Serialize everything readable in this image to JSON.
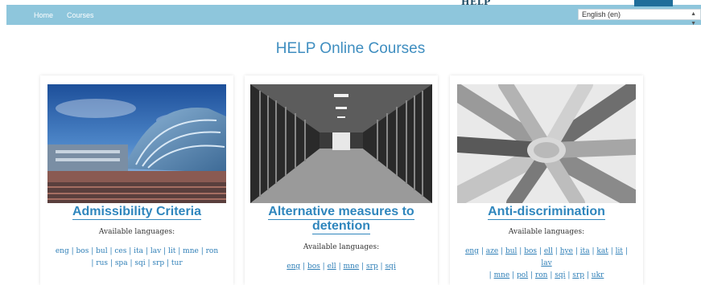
{
  "nav": {
    "home": "Home",
    "courses": "Courses"
  },
  "brand_fragment": "HELP",
  "language_select": {
    "value": "English (en)"
  },
  "page_title": "HELP Online Courses",
  "available_label": "Available languages:",
  "courses": [
    {
      "title": "Admissibility Criteria",
      "languages": [
        "eng",
        "bos",
        "bul",
        "ces",
        "ita",
        "lav",
        "lit",
        "mne",
        "ron",
        "rus",
        "spa",
        "sqi",
        "srp",
        "tur"
      ]
    },
    {
      "title_line1": "Alternative measures to",
      "title_line2": "detention",
      "languages": [
        "eng",
        "bos",
        "ell",
        "mne",
        "srp",
        "sqi"
      ]
    },
    {
      "title": "Anti-discrimination",
      "languages": [
        "eng",
        "aze",
        "bul",
        "bos",
        "ell",
        "hye",
        "ita",
        "kat",
        "lit",
        "lav",
        "mne",
        "pol",
        "ron",
        "sqi",
        "srp",
        "ukr"
      ]
    }
  ],
  "colors": {
    "topbar": "#8ec6dc",
    "link": "#2f7fb7",
    "title": "#3f8ec0"
  }
}
